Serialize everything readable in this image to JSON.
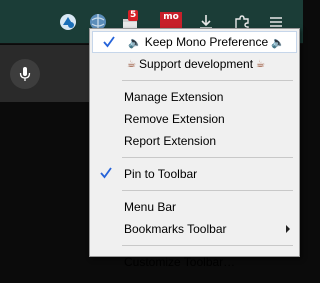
{
  "toolbar": {
    "icons": [
      "blue-extension-icon",
      "globe-extension-icon",
      "badge-extension-icon",
      "mono-extension-icon",
      "download-icon",
      "puzzle-icon",
      "hamburger-menu-icon"
    ],
    "badge_count": "5",
    "mono_badge": "mo"
  },
  "content": {
    "mic_icon": "microphone-icon"
  },
  "context_menu": {
    "keep_mono_preference": "Keep Mono Preference",
    "keep_mono_icon": "🔈",
    "support_development": "Support development",
    "support_icon": "☕",
    "manage_extension": "Manage Extension",
    "remove_extension": "Remove Extension",
    "report_extension": "Report Extension",
    "pin_to_toolbar": "Pin to Toolbar",
    "menu_bar": "Menu Bar",
    "bookmarks_toolbar": "Bookmarks Toolbar",
    "customize_toolbar": "Customize Toolbar…",
    "checked_items": [
      "Keep Mono Preference",
      "Pin to Toolbar"
    ],
    "accent_check": "#2563d9"
  }
}
